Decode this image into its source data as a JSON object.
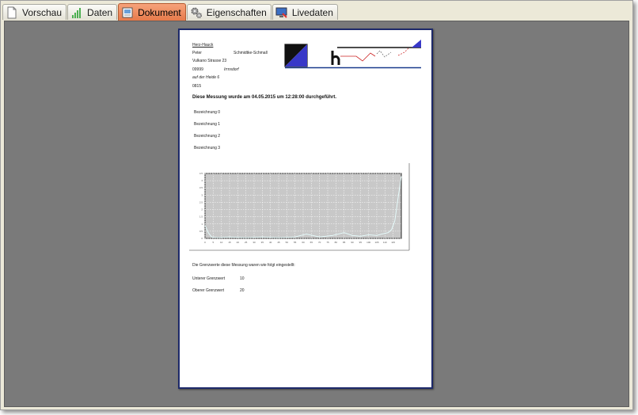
{
  "tabs": [
    {
      "label": "Vorschau",
      "icon": "document-icon"
    },
    {
      "label": "Daten",
      "icon": "bar-chart-icon"
    },
    {
      "label": "Dokument",
      "icon": "image-document-icon",
      "active": true
    },
    {
      "label": "Eigenschaften",
      "icon": "gears-icon"
    },
    {
      "label": "Livedaten",
      "icon": "monitor-icon"
    }
  ],
  "document": {
    "address": {
      "company": "Herz-Hauck",
      "firstname": "Peter",
      "lastname": "Schmidtke-Schmall",
      "street": "Vulkano Strasse 23",
      "zip": "09999",
      "city": "Irrnsdorf",
      "street2": "auf der Heide 6",
      "extra": "0815"
    },
    "measurement_text": "Diese Messung wurde am 04.05.2015 um 12:28:00 durchgeführt.",
    "labels": [
      "Bezeichnung 0",
      "Bezeichnung 1",
      "Bezeichnung 2",
      "Bezeichnung 3"
    ],
    "limits_intro": "Die Grenzwerte diese Messung waren wie folgt eingestellt:",
    "lower_limit_label": "Unterer Grenzwert",
    "lower_limit_value": "10",
    "upper_limit_label": "Oberer Grenzwert",
    "upper_limit_value": "20"
  },
  "chart_data": {
    "type": "line",
    "y_ticks": [
      "0",
      "0.5",
      "1",
      "1.5",
      "2",
      "2.5",
      "3",
      "3.5",
      "4",
      "4.5"
    ],
    "x_ticks": [
      "0",
      "5",
      "10",
      "15",
      "20",
      "25",
      "30",
      "35",
      "40",
      "45",
      "50",
      "55",
      "60",
      "65",
      "70",
      "75",
      "80",
      "85",
      "90",
      "95",
      "100",
      "105",
      "110",
      "115"
    ],
    "ylim": [
      0,
      4.5
    ],
    "xlim": [
      0,
      120
    ],
    "grid": true,
    "series": [
      {
        "color": "#e8ffff",
        "x": [
          0,
          2,
          4,
          8,
          15,
          25,
          35,
          45,
          55,
          62,
          70,
          78,
          85,
          90,
          95,
          100,
          105,
          108,
          112,
          114,
          116,
          118,
          120
        ],
        "y": [
          0.9,
          0.4,
          0.1,
          0.05,
          0.1,
          0.05,
          0.1,
          0.05,
          0.1,
          0.3,
          0.1,
          0.2,
          0.4,
          0.2,
          0.15,
          0.25,
          0.2,
          0.3,
          0.4,
          0.6,
          1.2,
          2.8,
          4.3
        ]
      }
    ]
  },
  "colors": {
    "active_tab": "#e67a4a",
    "page_border": "#1e2a6a",
    "workspace": "#7a7a7a",
    "logo_blue": "#3838c8"
  }
}
